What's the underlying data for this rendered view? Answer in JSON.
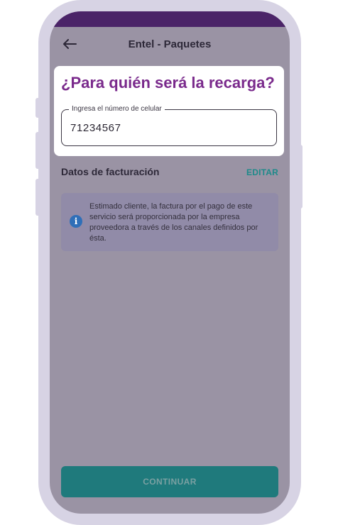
{
  "header": {
    "title": "Entel - Paquetes",
    "back_icon": "arrow-left-icon"
  },
  "recharge": {
    "question": "¿Para quién será la recarga?",
    "phone_label": "Ingresa el número de celular",
    "phone_value": "71234567"
  },
  "billing": {
    "title": "Datos de facturación",
    "edit_label": "EDITAR",
    "info_icon": "info-icon",
    "info_text": "Estimado cliente, la factura por el pago de este servicio será proporcionada por la empresa proveedora a través de los canales definidos por ésta."
  },
  "footer": {
    "continue_label": "CONTINUAR"
  },
  "colors": {
    "status_bar": "#4b2468",
    "question": "#7a2a8c",
    "accent": "#1e8a8a",
    "button": "#1f7a7c",
    "overlay": "#9a93a4"
  }
}
